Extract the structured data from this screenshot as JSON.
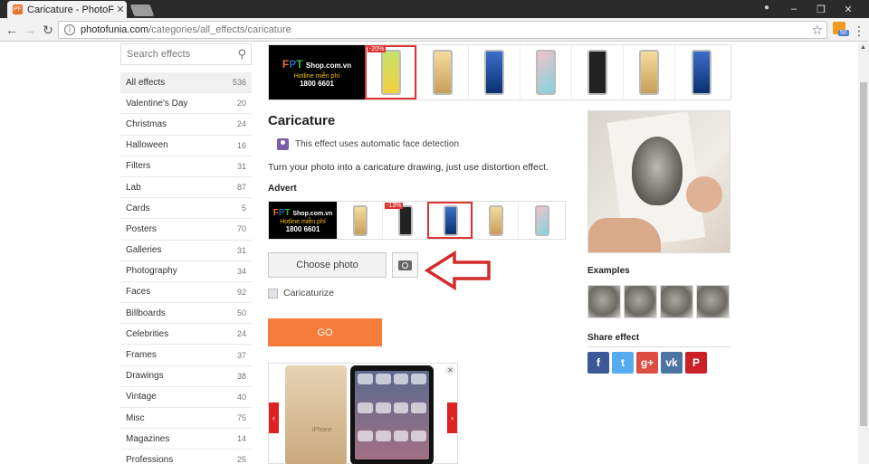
{
  "browser": {
    "tab_title": "Caricature - PhotoFunia",
    "favicon": "PF",
    "url_host": "photofunia.com",
    "url_path": "/categories/all_effects/caricature",
    "rss_badge": "50"
  },
  "sidebar": {
    "search_placeholder": "Search effects",
    "categories": [
      {
        "label": "All effects",
        "count": "536"
      },
      {
        "label": "Valentine's Day",
        "count": "20"
      },
      {
        "label": "Christmas",
        "count": "24"
      },
      {
        "label": "Halloween",
        "count": "16"
      },
      {
        "label": "Filters",
        "count": "31"
      },
      {
        "label": "Lab",
        "count": "87"
      },
      {
        "label": "Cards",
        "count": "5"
      },
      {
        "label": "Posters",
        "count": "70"
      },
      {
        "label": "Galleries",
        "count": "31"
      },
      {
        "label": "Photography",
        "count": "34"
      },
      {
        "label": "Faces",
        "count": "92"
      },
      {
        "label": "Billboards",
        "count": "50"
      },
      {
        "label": "Celebrities",
        "count": "24"
      },
      {
        "label": "Frames",
        "count": "37"
      },
      {
        "label": "Drawings",
        "count": "38"
      },
      {
        "label": "Vintage",
        "count": "40"
      },
      {
        "label": "Misc",
        "count": "75"
      },
      {
        "label": "Magazines",
        "count": "14"
      },
      {
        "label": "Professions",
        "count": "25"
      }
    ]
  },
  "ad": {
    "brand_f": "F",
    "brand_p": "P",
    "brand_t": "T",
    "brand_rest": "Shop.com.vn",
    "hotline": "Hotline miễn phí",
    "phone": "1800 6601",
    "discount_top": "-20%",
    "discount_mid": "-13%",
    "iphone_text": "iPhone"
  },
  "effect": {
    "title": "Caricature",
    "face_detect": "This effect uses automatic face detection",
    "description": "Turn your photo into a caricature drawing, just use distortion effect.",
    "advert_label": "Advert",
    "choose_photo": "Choose photo",
    "caricaturize_label": "Caricaturize",
    "go_label": "GO"
  },
  "right": {
    "examples_label": "Examples",
    "share_label": "Share effect",
    "social": [
      {
        "name": "facebook",
        "glyph": "f",
        "color": "#3b5998"
      },
      {
        "name": "twitter",
        "glyph": "t",
        "color": "#55acee"
      },
      {
        "name": "google-plus",
        "glyph": "g+",
        "color": "#dc4e41"
      },
      {
        "name": "vk",
        "glyph": "vk",
        "color": "#4c75a3"
      },
      {
        "name": "pinterest",
        "glyph": "P",
        "color": "#cb2027"
      }
    ]
  }
}
